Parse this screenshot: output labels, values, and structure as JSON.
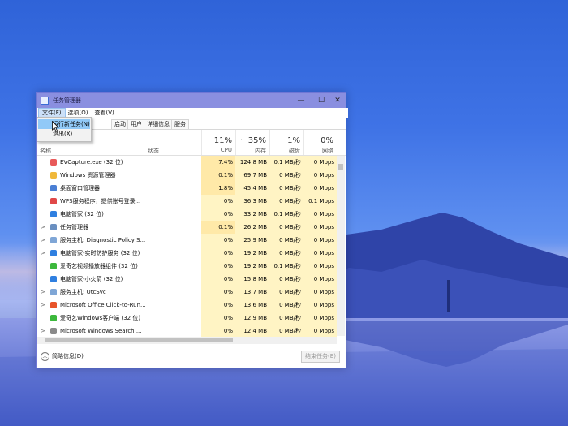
{
  "window": {
    "title": "任务管理器",
    "controls": [
      "—",
      "☐",
      "✕"
    ]
  },
  "menu": [
    "文件(F)",
    "选项(O)",
    "查看(V)"
  ],
  "file_menu": {
    "items": [
      "运行新任务(N)",
      "退出(X)"
    ],
    "highlighted_index": 0
  },
  "tabs": [
    "启动",
    "用户",
    "详细信息",
    "服务"
  ],
  "header": {
    "name_label": "名称",
    "status_label": "状态",
    "cpu": {
      "pct": "11%",
      "label": "CPU"
    },
    "mem": {
      "pct": "35%",
      "label": "内存"
    },
    "disk": {
      "pct": "1%",
      "label": "磁盘"
    },
    "net": {
      "pct": "0%",
      "label": "网络"
    },
    "sort_arrow": "⌄"
  },
  "processes": [
    {
      "expand": "",
      "icon": "evcapture-icon",
      "color": "#e85a5a",
      "name": "EVCapture.exe (32 位)",
      "cpu": "7.4%",
      "mem": "124.8 MB",
      "disk": "0.1 MB/秒",
      "net": "0 Mbps"
    },
    {
      "expand": "",
      "icon": "explorer-folder-icon",
      "color": "#f0b83a",
      "name": "Windows 资源管理器",
      "cpu": "0.1%",
      "mem": "69.7 MB",
      "disk": "0 MB/秒",
      "net": "0 Mbps"
    },
    {
      "expand": "",
      "icon": "dwm-icon",
      "color": "#4a7fd4",
      "name": "桌面窗口管理器",
      "cpu": "1.8%",
      "mem": "45.4 MB",
      "disk": "0 MB/秒",
      "net": "0 Mbps"
    },
    {
      "expand": "",
      "icon": "wps-icon",
      "color": "#e04848",
      "name": "WPS服务程序，提供账号登录...",
      "cpu": "0%",
      "mem": "36.3 MB",
      "disk": "0 MB/秒",
      "net": "0.1 Mbps"
    },
    {
      "expand": "",
      "icon": "pc-manager-icon",
      "color": "#2f7fe0",
      "name": "电脑管家 (32 位)",
      "cpu": "0%",
      "mem": "33.2 MB",
      "disk": "0.1 MB/秒",
      "net": "0 Mbps"
    },
    {
      "expand": ">",
      "icon": "task-manager-icon",
      "color": "#6a8fc0",
      "name": "任务管理器",
      "cpu": "0.1%",
      "mem": "26.2 MB",
      "disk": "0 MB/秒",
      "net": "0 Mbps"
    },
    {
      "expand": ">",
      "icon": "service-host-icon",
      "color": "#7fa6d6",
      "name": "服务主机: Diagnostic Policy S...",
      "cpu": "0%",
      "mem": "25.9 MB",
      "disk": "0 MB/秒",
      "net": "0 Mbps"
    },
    {
      "expand": ">",
      "icon": "pc-manager-shield-icon",
      "color": "#2f7fe0",
      "name": "电脑管家-实时防护服务 (32 位)",
      "cpu": "0%",
      "mem": "19.2 MB",
      "disk": "0 MB/秒",
      "net": "0 Mbps"
    },
    {
      "expand": "",
      "icon": "iqiyi-icon",
      "color": "#3cb83c",
      "name": "爱奇艺视频播放器组件 (32 位)",
      "cpu": "0%",
      "mem": "19.2 MB",
      "disk": "0.1 MB/秒",
      "net": "0 Mbps"
    },
    {
      "expand": "",
      "icon": "pc-manager-rocket-icon",
      "color": "#2f7fe0",
      "name": "电脑管家-小火箭 (32 位)",
      "cpu": "0%",
      "mem": "15.8 MB",
      "disk": "0 MB/秒",
      "net": "0 Mbps"
    },
    {
      "expand": ">",
      "icon": "service-host-icon",
      "color": "#7fa6d6",
      "name": "服务主机: UtcSvc",
      "cpu": "0%",
      "mem": "13.7 MB",
      "disk": "0 MB/秒",
      "net": "0 Mbps"
    },
    {
      "expand": ">",
      "icon": "office-icon",
      "color": "#e8552a",
      "name": "Microsoft Office Click-to-Run...",
      "cpu": "0%",
      "mem": "13.6 MB",
      "disk": "0 MB/秒",
      "net": "0 Mbps"
    },
    {
      "expand": "",
      "icon": "iqiyi-icon",
      "color": "#3cb83c",
      "name": "爱奇艺Windows客户端 (32 位)",
      "cpu": "0%",
      "mem": "12.9 MB",
      "disk": "0 MB/秒",
      "net": "0 Mbps"
    },
    {
      "expand": ">",
      "icon": "windows-search-icon",
      "color": "#8a8a8a",
      "name": "Microsoft Windows Search ...",
      "cpu": "0%",
      "mem": "12.4 MB",
      "disk": "0 MB/秒",
      "net": "0 Mbps"
    }
  ],
  "footer": {
    "less_details_icon": "collapse-chevron-icon",
    "less_details": "简略信息(D)",
    "end_task": "结束任务(E)"
  },
  "colors": {
    "titlebar": "#8a8fe0",
    "cpu_col": "#fff4c4",
    "cpu_col_hot": "#ffe9a8",
    "data_col": "#fff4c4",
    "menu_highlight": "#91c9f7"
  }
}
